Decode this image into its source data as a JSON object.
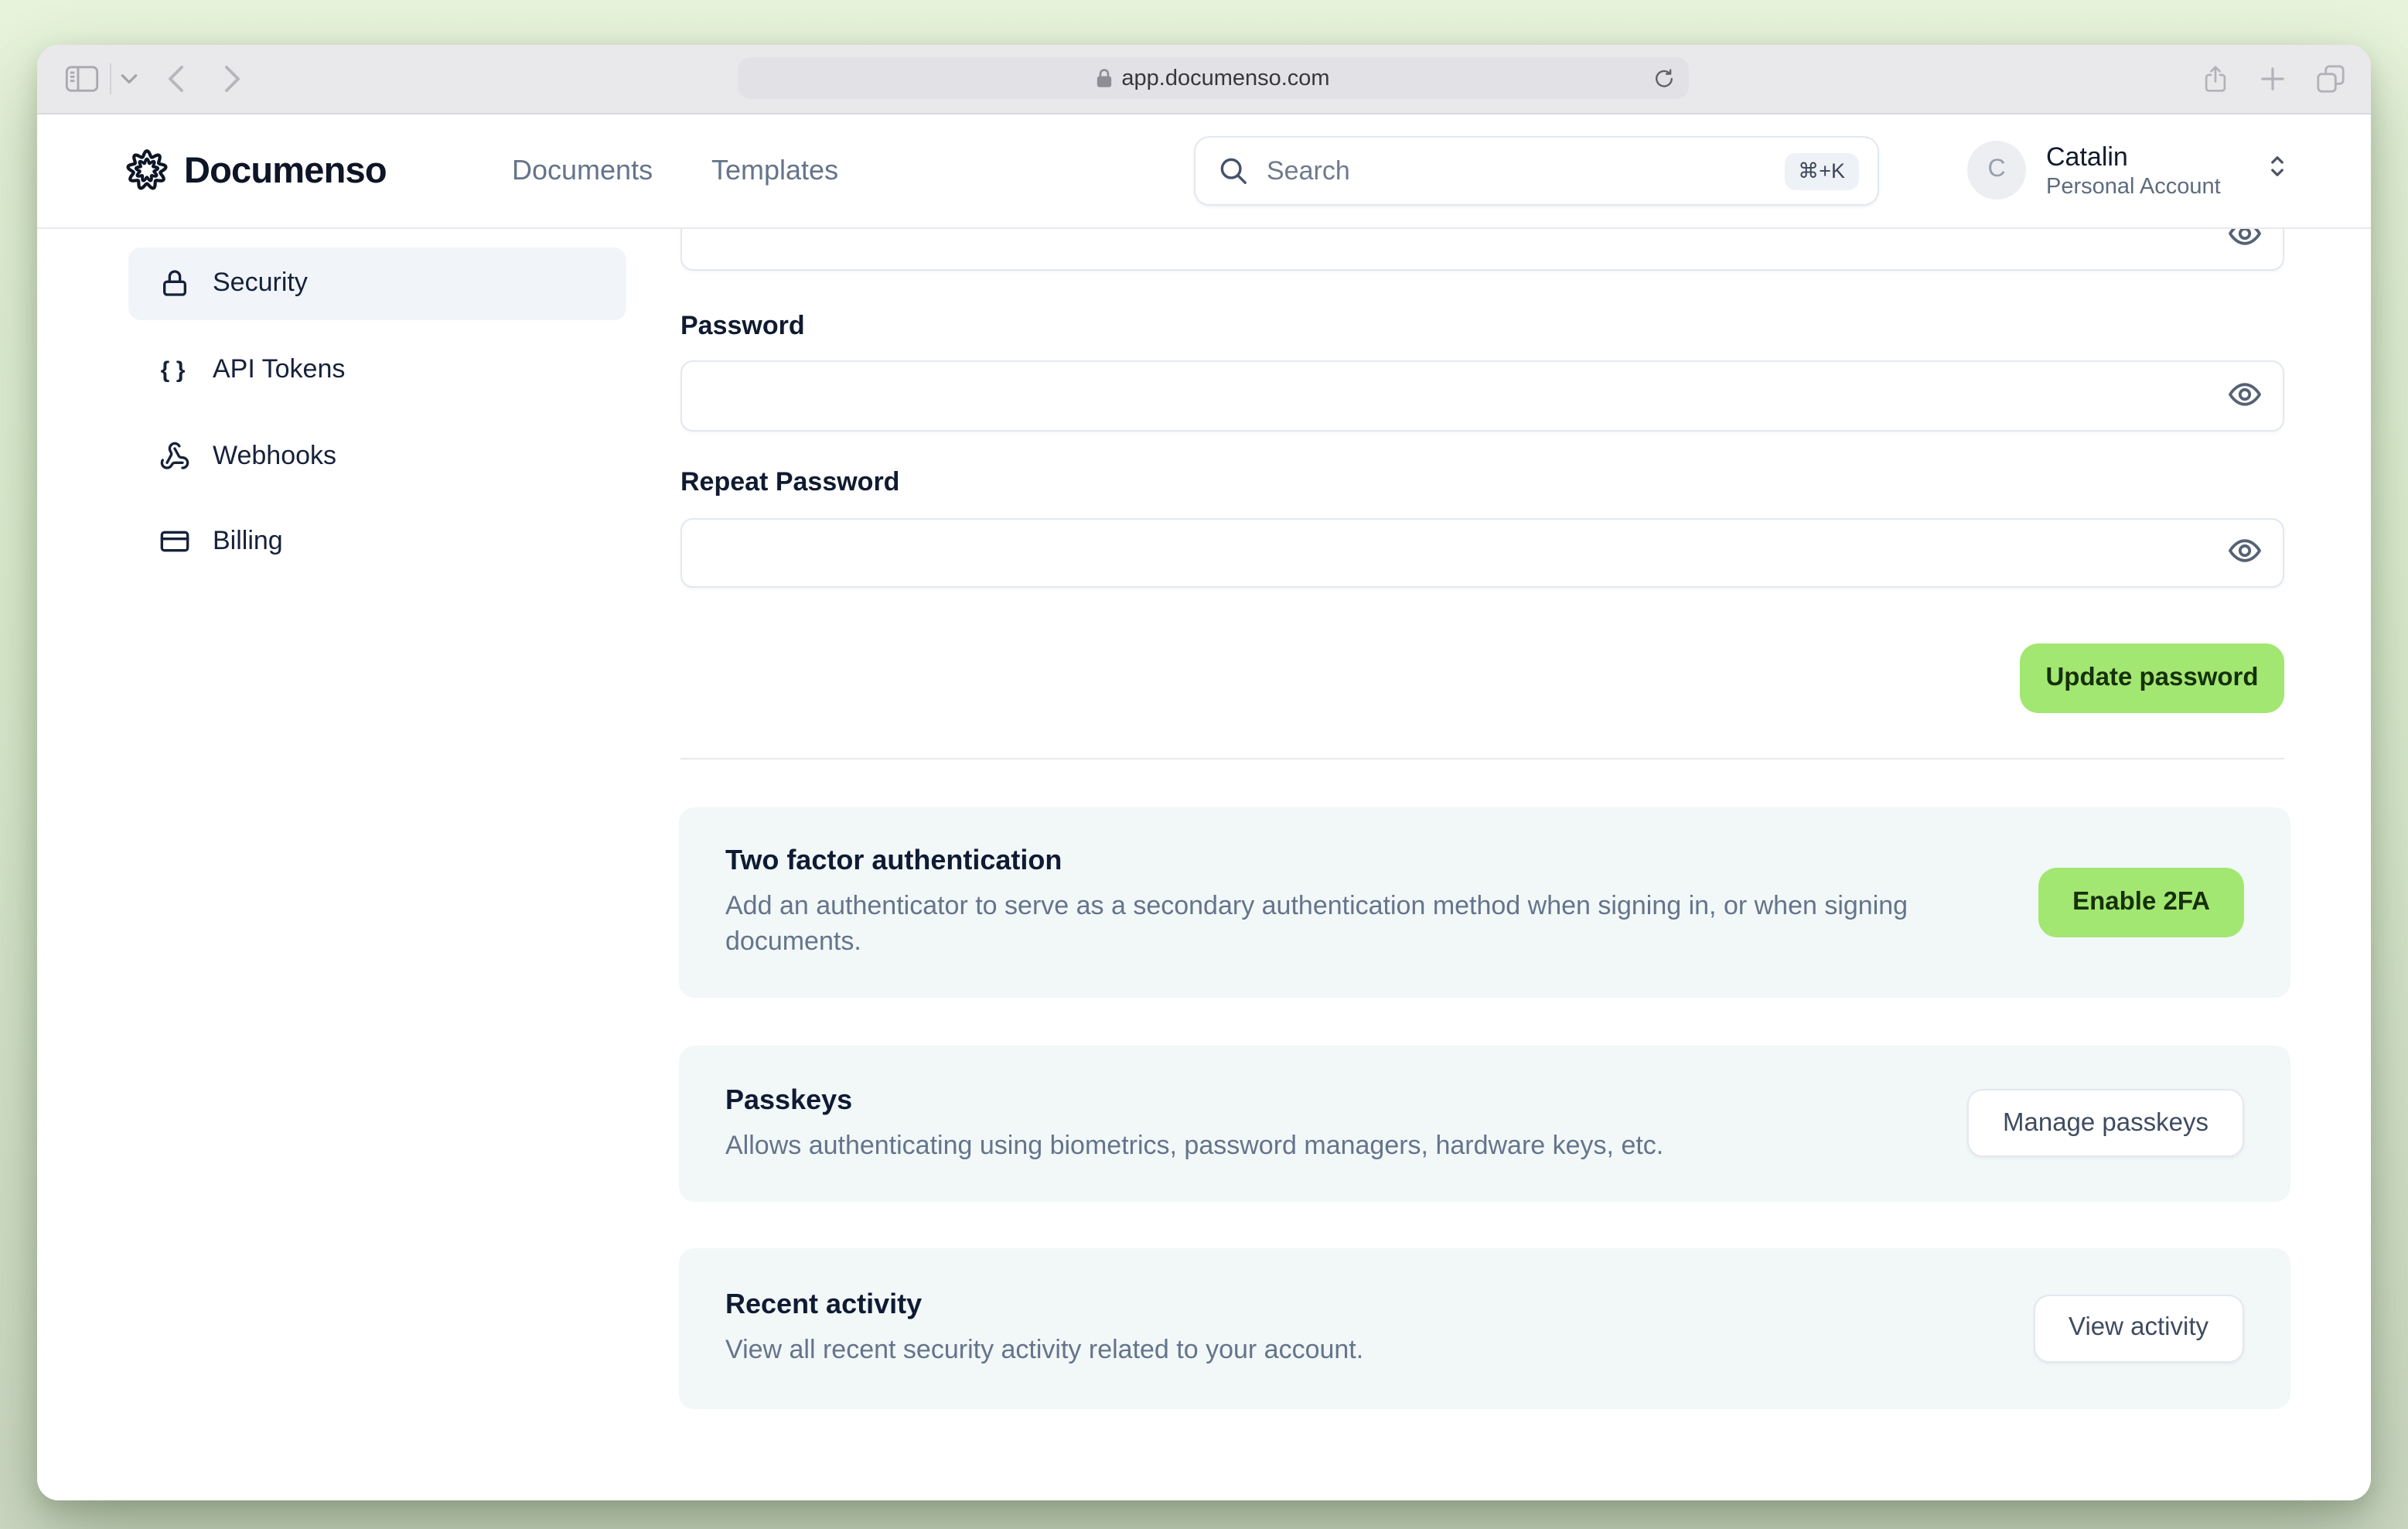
{
  "colors": {
    "brand_green": "#a2e771",
    "brand_navy": "#0d1526",
    "card_bg": "#f2f7f8",
    "desktop_green_top": "#e7f4db",
    "desktop_green_bottom": "#cdd9c4"
  },
  "browser": {
    "url": "app.documenso.com",
    "icons": {
      "left": [
        "sidebar-panel",
        "chevron-down",
        "back",
        "forward"
      ],
      "url_field": [
        "padlock",
        "reload"
      ],
      "right": [
        "share",
        "new-tab",
        "tab-overview"
      ]
    }
  },
  "header": {
    "brand": "Documenso",
    "logo_icon": "documenso-rosette",
    "nav": [
      {
        "label": "Documents"
      },
      {
        "label": "Templates"
      }
    ],
    "search": {
      "placeholder": "Search",
      "shortcut": "⌘+K",
      "icon": "magnifier"
    },
    "account": {
      "initial": "C",
      "name": "Catalin",
      "type": "Personal Account",
      "icon": "chevrons-up-down"
    }
  },
  "sidebar": {
    "items": [
      {
        "label": "Security",
        "icon": "lock",
        "active": true
      },
      {
        "label": "API Tokens",
        "icon": "curly-braces",
        "active": false
      },
      {
        "label": "Webhooks",
        "icon": "webhook",
        "active": false
      },
      {
        "label": "Billing",
        "icon": "credit-card",
        "active": false
      }
    ]
  },
  "form": {
    "partial_field": {
      "value": "",
      "icon": "eye"
    },
    "password": {
      "label": "Password",
      "value": "",
      "icon": "eye"
    },
    "repeat_password": {
      "label": "Repeat Password",
      "value": "",
      "icon": "eye"
    },
    "submit_label": "Update password"
  },
  "sections": [
    {
      "title": "Two factor authentication",
      "description": "Add an authenticator to serve as a secondary authentication method when signing in, or when signing documents.",
      "action": "Enable 2FA",
      "action_style": "primary"
    },
    {
      "title": "Passkeys",
      "description": "Allows authenticating using biometrics, password managers, hardware keys, etc.",
      "action": "Manage passkeys",
      "action_style": "outline"
    },
    {
      "title": "Recent activity",
      "description": "View all recent security activity related to your account.",
      "action": "View activity",
      "action_style": "outline"
    }
  ]
}
